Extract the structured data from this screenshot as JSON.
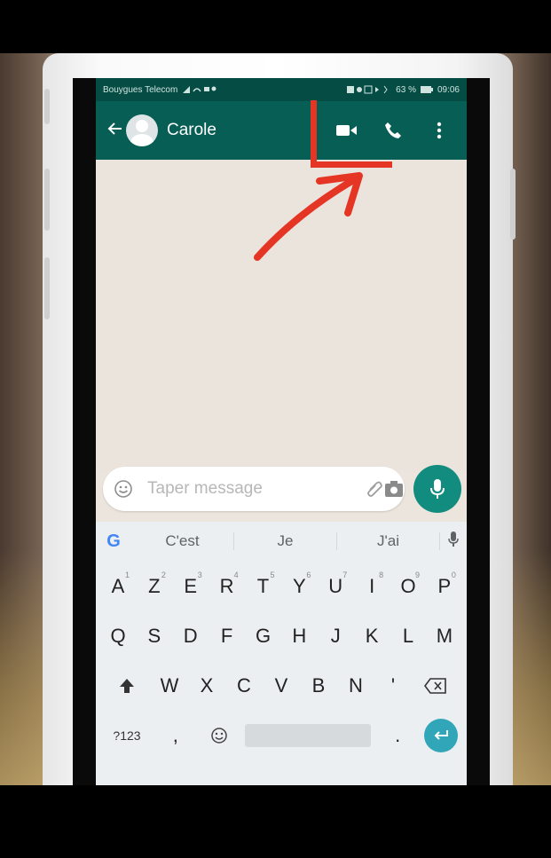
{
  "status_bar": {
    "carrier": "Bouygues Telecom",
    "battery": "63 %",
    "time": "09:06"
  },
  "chat_header": {
    "contact_name": "Carole",
    "icons": [
      "back-arrow-icon",
      "video-call-icon",
      "phone-call-icon",
      "more-options-icon"
    ]
  },
  "composer": {
    "placeholder": "Taper message",
    "icons": [
      "emoji-icon",
      "attachment-icon",
      "camera-icon",
      "microphone-icon"
    ]
  },
  "keyboard": {
    "suggestions": [
      "C'est",
      "Je",
      "J'ai"
    ],
    "rows": [
      [
        {
          "k": "A",
          "s": "1"
        },
        {
          "k": "Z",
          "s": "2"
        },
        {
          "k": "E",
          "s": "3"
        },
        {
          "k": "R",
          "s": "4"
        },
        {
          "k": "T",
          "s": "5"
        },
        {
          "k": "Y",
          "s": "6"
        },
        {
          "k": "U",
          "s": "7"
        },
        {
          "k": "I",
          "s": "8"
        },
        {
          "k": "O",
          "s": "9"
        },
        {
          "k": "P",
          "s": "0"
        }
      ],
      [
        {
          "k": "Q"
        },
        {
          "k": "S"
        },
        {
          "k": "D"
        },
        {
          "k": "F"
        },
        {
          "k": "G"
        },
        {
          "k": "H"
        },
        {
          "k": "J"
        },
        {
          "k": "K"
        },
        {
          "k": "L"
        },
        {
          "k": "M"
        }
      ],
      [
        {
          "k": "W"
        },
        {
          "k": "X"
        },
        {
          "k": "C"
        },
        {
          "k": "V"
        },
        {
          "k": "B"
        },
        {
          "k": "N"
        },
        {
          "k": "'"
        }
      ]
    ],
    "symbols_key": "?123",
    "comma_key": ",",
    "period_key": "."
  },
  "colors": {
    "whatsapp_dark": "#075e54",
    "whatsapp_teal": "#128c7e",
    "annotation_red": "#e53525"
  }
}
